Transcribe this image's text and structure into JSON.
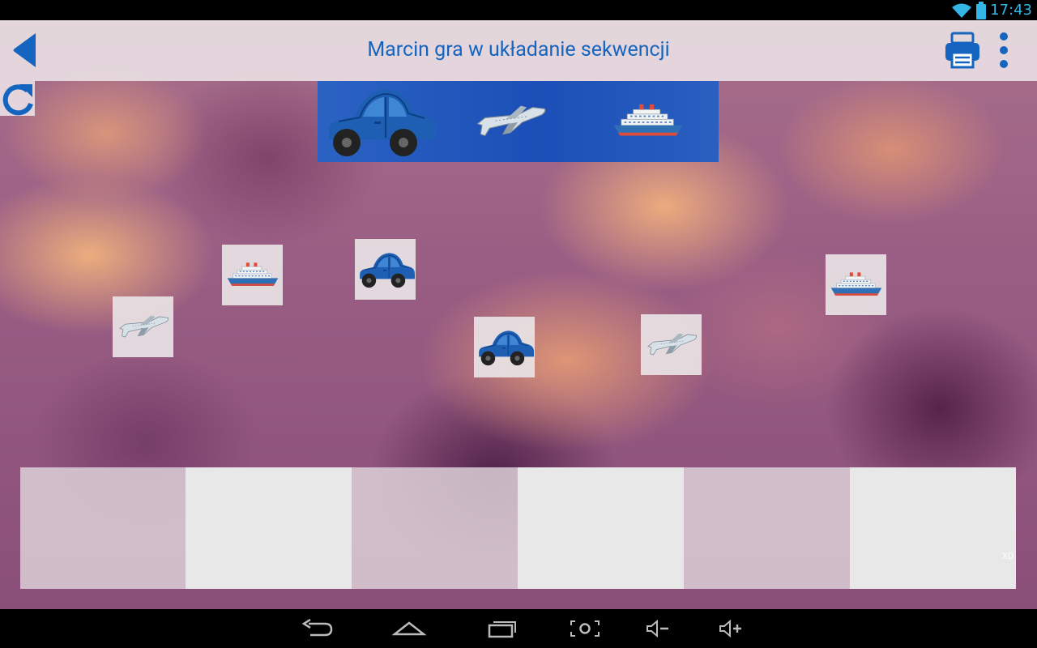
{
  "status_bar": {
    "time": "17:43",
    "icons": [
      "wifi-icon",
      "battery-icon"
    ]
  },
  "header": {
    "title": "Marcin gra w układanie sekwencji",
    "actions": [
      "back-icon",
      "print-icon",
      "overflow-menu-icon"
    ]
  },
  "refresh": {
    "icon": "refresh-icon"
  },
  "sequence": {
    "items": [
      "car-icon",
      "airplane-icon",
      "ship-icon"
    ]
  },
  "tiles": [
    {
      "icon": "airplane-icon"
    },
    {
      "icon": "ship-icon"
    },
    {
      "icon": "car-icon"
    },
    {
      "icon": "car-icon"
    },
    {
      "icon": "airplane-icon"
    },
    {
      "icon": "ship-icon"
    }
  ],
  "drop_slots": {
    "count": 6
  },
  "corner_label": "XD",
  "nav_bar": {
    "buttons": [
      "back-nav-icon",
      "home-icon",
      "recent-apps-icon",
      "screenshot-icon",
      "volume-down-icon",
      "volume-up-icon"
    ]
  },
  "colors": {
    "accent": "#1565c0",
    "sequence_bg": "#1f55b9",
    "status_time": "#33b5e5"
  }
}
